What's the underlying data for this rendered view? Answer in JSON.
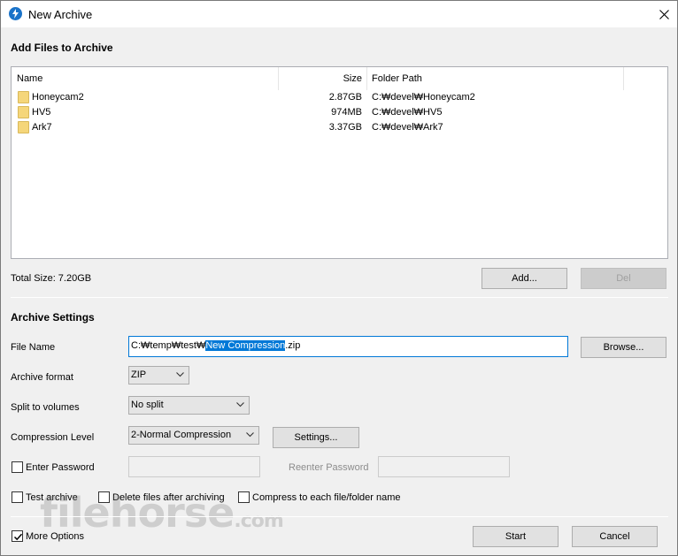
{
  "window": {
    "title": "New Archive"
  },
  "add_files": {
    "heading": "Add Files to Archive",
    "columns": {
      "name": "Name",
      "size": "Size",
      "path": "Folder Path"
    },
    "rows": [
      {
        "name": "Honeycam2",
        "size": "2.87GB",
        "path": "C:₩devel₩Honeycam2"
      },
      {
        "name": "HV5",
        "size": "974MB",
        "path": "C:₩devel₩HV5"
      },
      {
        "name": "Ark7",
        "size": "3.37GB",
        "path": "C:₩devel₩Ark7"
      }
    ],
    "total_size": "Total Size: 7.20GB",
    "add_button": "Add...",
    "del_button": "Del"
  },
  "settings": {
    "heading": "Archive Settings",
    "file_name_label": "File Name",
    "file_name_prefix": "C:₩temp₩test₩",
    "file_name_selected": "New Compression",
    "file_name_suffix": ".zip",
    "browse_button": "Browse...",
    "archive_format_label": "Archive format",
    "archive_format_value": "ZIP",
    "split_label": "Split to volumes",
    "split_value": "No split",
    "compression_label": "Compression Level",
    "compression_value": "2-Normal Compression",
    "settings_button": "Settings...",
    "enter_password_label": "Enter Password",
    "reenter_password_label": "Reenter Password",
    "test_archive_label": "Test archive",
    "delete_files_label": "Delete files after archiving",
    "compress_each_label": "Compress to each file/folder name"
  },
  "footer": {
    "more_options_label": "More Options",
    "more_options_checked": true,
    "start_button": "Start",
    "cancel_button": "Cancel"
  },
  "watermark": "filehorse.com"
}
